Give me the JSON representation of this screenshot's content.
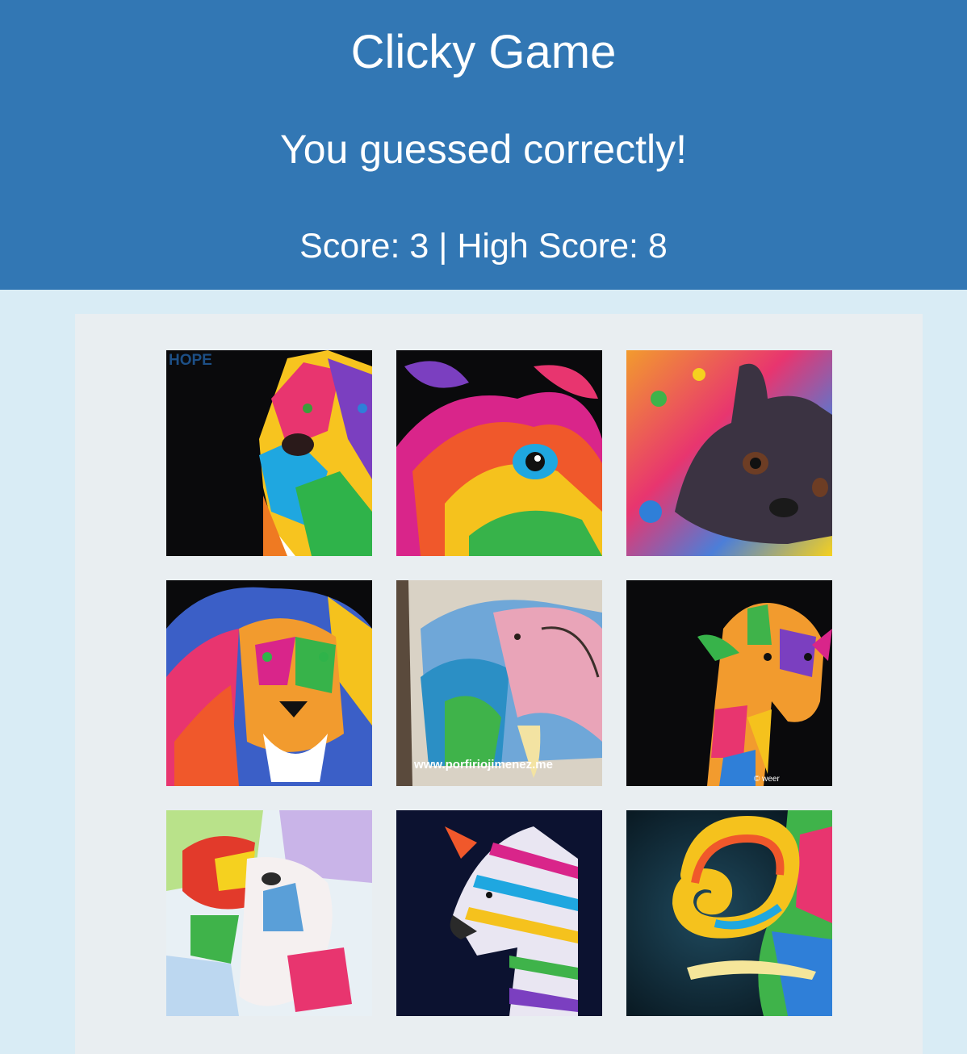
{
  "header": {
    "title": "Clicky Game",
    "message": "You guessed correctly!",
    "score_label": "Score: 3 | High Score: 8"
  },
  "colors": {
    "header_bg": "#3277b4",
    "page_bg": "#d9ecf5",
    "board_bg": "#e9eef1"
  },
  "cards": [
    {
      "name": "rainbow-dog-painting",
      "caption": "HOPE"
    },
    {
      "name": "rainbow-bird-painting",
      "caption": ""
    },
    {
      "name": "french-bulldog-painting",
      "caption": ""
    },
    {
      "name": "rainbow-lion-painting",
      "caption": ""
    },
    {
      "name": "watercolor-elephant-painting",
      "caption": "www.porfiriojimenez.me"
    },
    {
      "name": "rainbow-giraffe-painting",
      "caption": "© weer"
    },
    {
      "name": "abstract-cow-painting",
      "caption": ""
    },
    {
      "name": "rainbow-zebra-painting",
      "caption": ""
    },
    {
      "name": "rainbow-elephant-trunk-painting",
      "caption": ""
    }
  ]
}
